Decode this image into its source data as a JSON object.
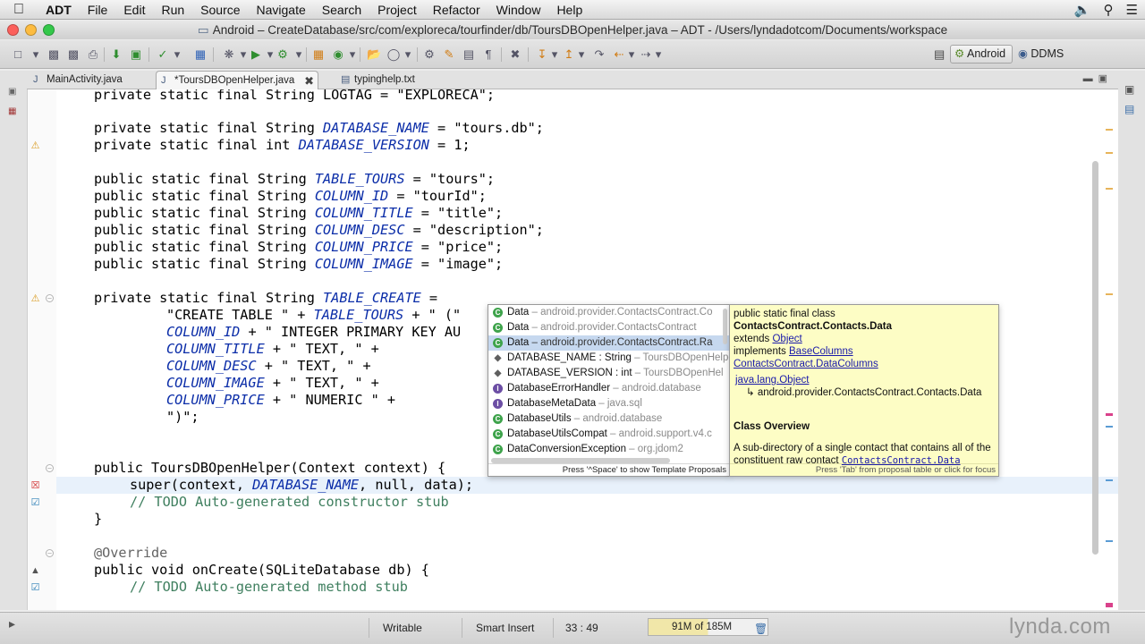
{
  "menubar": {
    "app": "ADT",
    "items": [
      "File",
      "Edit",
      "Run",
      "Source",
      "Navigate",
      "Search",
      "Project",
      "Refactor",
      "Window",
      "Help"
    ]
  },
  "window": {
    "title": "Android – CreateDatabase/src/com/exploreca/tourfinder/db/ToursDBOpenHelper.java – ADT - /Users/lyndadotcom/Documents/workspace"
  },
  "perspectives": {
    "android": "Android",
    "ddms": "DDMS"
  },
  "tabs": [
    {
      "label": "MainActivity.java"
    },
    {
      "label": "*ToursDBOpenHelper.java"
    },
    {
      "label": "typinghelp.txt"
    }
  ],
  "code": {
    "line0": "private static final String LOGTAG = \"EXPLORECA\";",
    "line1": "private static final String DATABASE_NAME = \"tours.db\";",
    "line2": "private static final int DATABASE_VERSION = 1;",
    "line3": "public static final String TABLE_TOURS = \"tours\";",
    "line4": "public static final String COLUMN_ID = \"tourId\";",
    "line5": "public static final String COLUMN_TITLE = \"title\";",
    "line6": "public static final String COLUMN_DESC = \"description\";",
    "line7": "public static final String COLUMN_PRICE = \"price\";",
    "line8": "public static final String COLUMN_IMAGE = \"image\";",
    "line9": "private static final String TABLE_CREATE =",
    "line10": "\"CREATE TABLE \" + TABLE_TOURS + \" (\"",
    "line11": "COLUMN_ID + \" INTEGER PRIMARY KEY AU",
    "line12": "COLUMN_TITLE + \" TEXT, \" +",
    "line13": "COLUMN_DESC + \" TEXT, \" +",
    "line14": "COLUMN_IMAGE + \" TEXT, \" +",
    "line15": "COLUMN_PRICE + \" NUMERIC \" +",
    "line16": "\")\";",
    "line17": "public ToursDBOpenHelper(Context context) {",
    "line18a": "super(context, ",
    "line18b": "DATABASE_NAME",
    "line18c": ", null, data);",
    "line19": "// TODO Auto-generated constructor stub",
    "line20": "}",
    "line21": "@Override",
    "line22": "public void onCreate(SQLiteDatabase db) {",
    "line23": "// TODO Auto-generated method stub"
  },
  "assist": {
    "proposals": [
      {
        "name": "Data",
        "qualifier": " – android.provider.ContactsContract.Co",
        "kind": "class"
      },
      {
        "name": "Data",
        "qualifier": " – android.provider.ContactsContract",
        "kind": "class"
      },
      {
        "name": "Data",
        "qualifier": " – android.provider.ContactsContract.Ra",
        "kind": "class"
      },
      {
        "name": "DATABASE_NAME : String",
        "qualifier": " – ToursDBOpenHelpe",
        "kind": "field"
      },
      {
        "name": "DATABASE_VERSION : int",
        "qualifier": " – ToursDBOpenHel",
        "kind": "field"
      },
      {
        "name": "DatabaseErrorHandler",
        "qualifier": " – android.database",
        "kind": "interface"
      },
      {
        "name": "DatabaseMetaData",
        "qualifier": " – java.sql",
        "kind": "interface"
      },
      {
        "name": "DatabaseUtils",
        "qualifier": " – android.database",
        "kind": "class"
      },
      {
        "name": "DatabaseUtilsCompat",
        "qualifier": " – android.support.v4.c",
        "kind": "class"
      },
      {
        "name": "DataConversionException",
        "qualifier": " – org.jdom2",
        "kind": "class"
      }
    ],
    "selected_index": 2,
    "hint": "Press '^Space' to show Template Proposals"
  },
  "doc": {
    "modifiers": "public static final class",
    "name": "ContactsContract.Contacts.Data",
    "extends_label": "extends",
    "extends_link": "Object",
    "implements_label": "implements",
    "impl1": "BaseColumns",
    "impl2": "ContactsContract.DataColumns",
    "hier1": "java.lang.Object",
    "hier2": "↳ android.provider.ContactsContract.Contacts.Data",
    "overview_title": "Class Overview",
    "overview_text": "A sub-directory of a single contact that contains all of the constituent raw contact",
    "overview_link": "ContactsContract.Data",
    "hint": "Press 'Tab' from proposal table or click for focus"
  },
  "status": {
    "writable": "Writable",
    "insert_mode": "Smart Insert",
    "position": "33 : 49",
    "heap": "91M of 185M",
    "watermark": "lynda.com"
  }
}
